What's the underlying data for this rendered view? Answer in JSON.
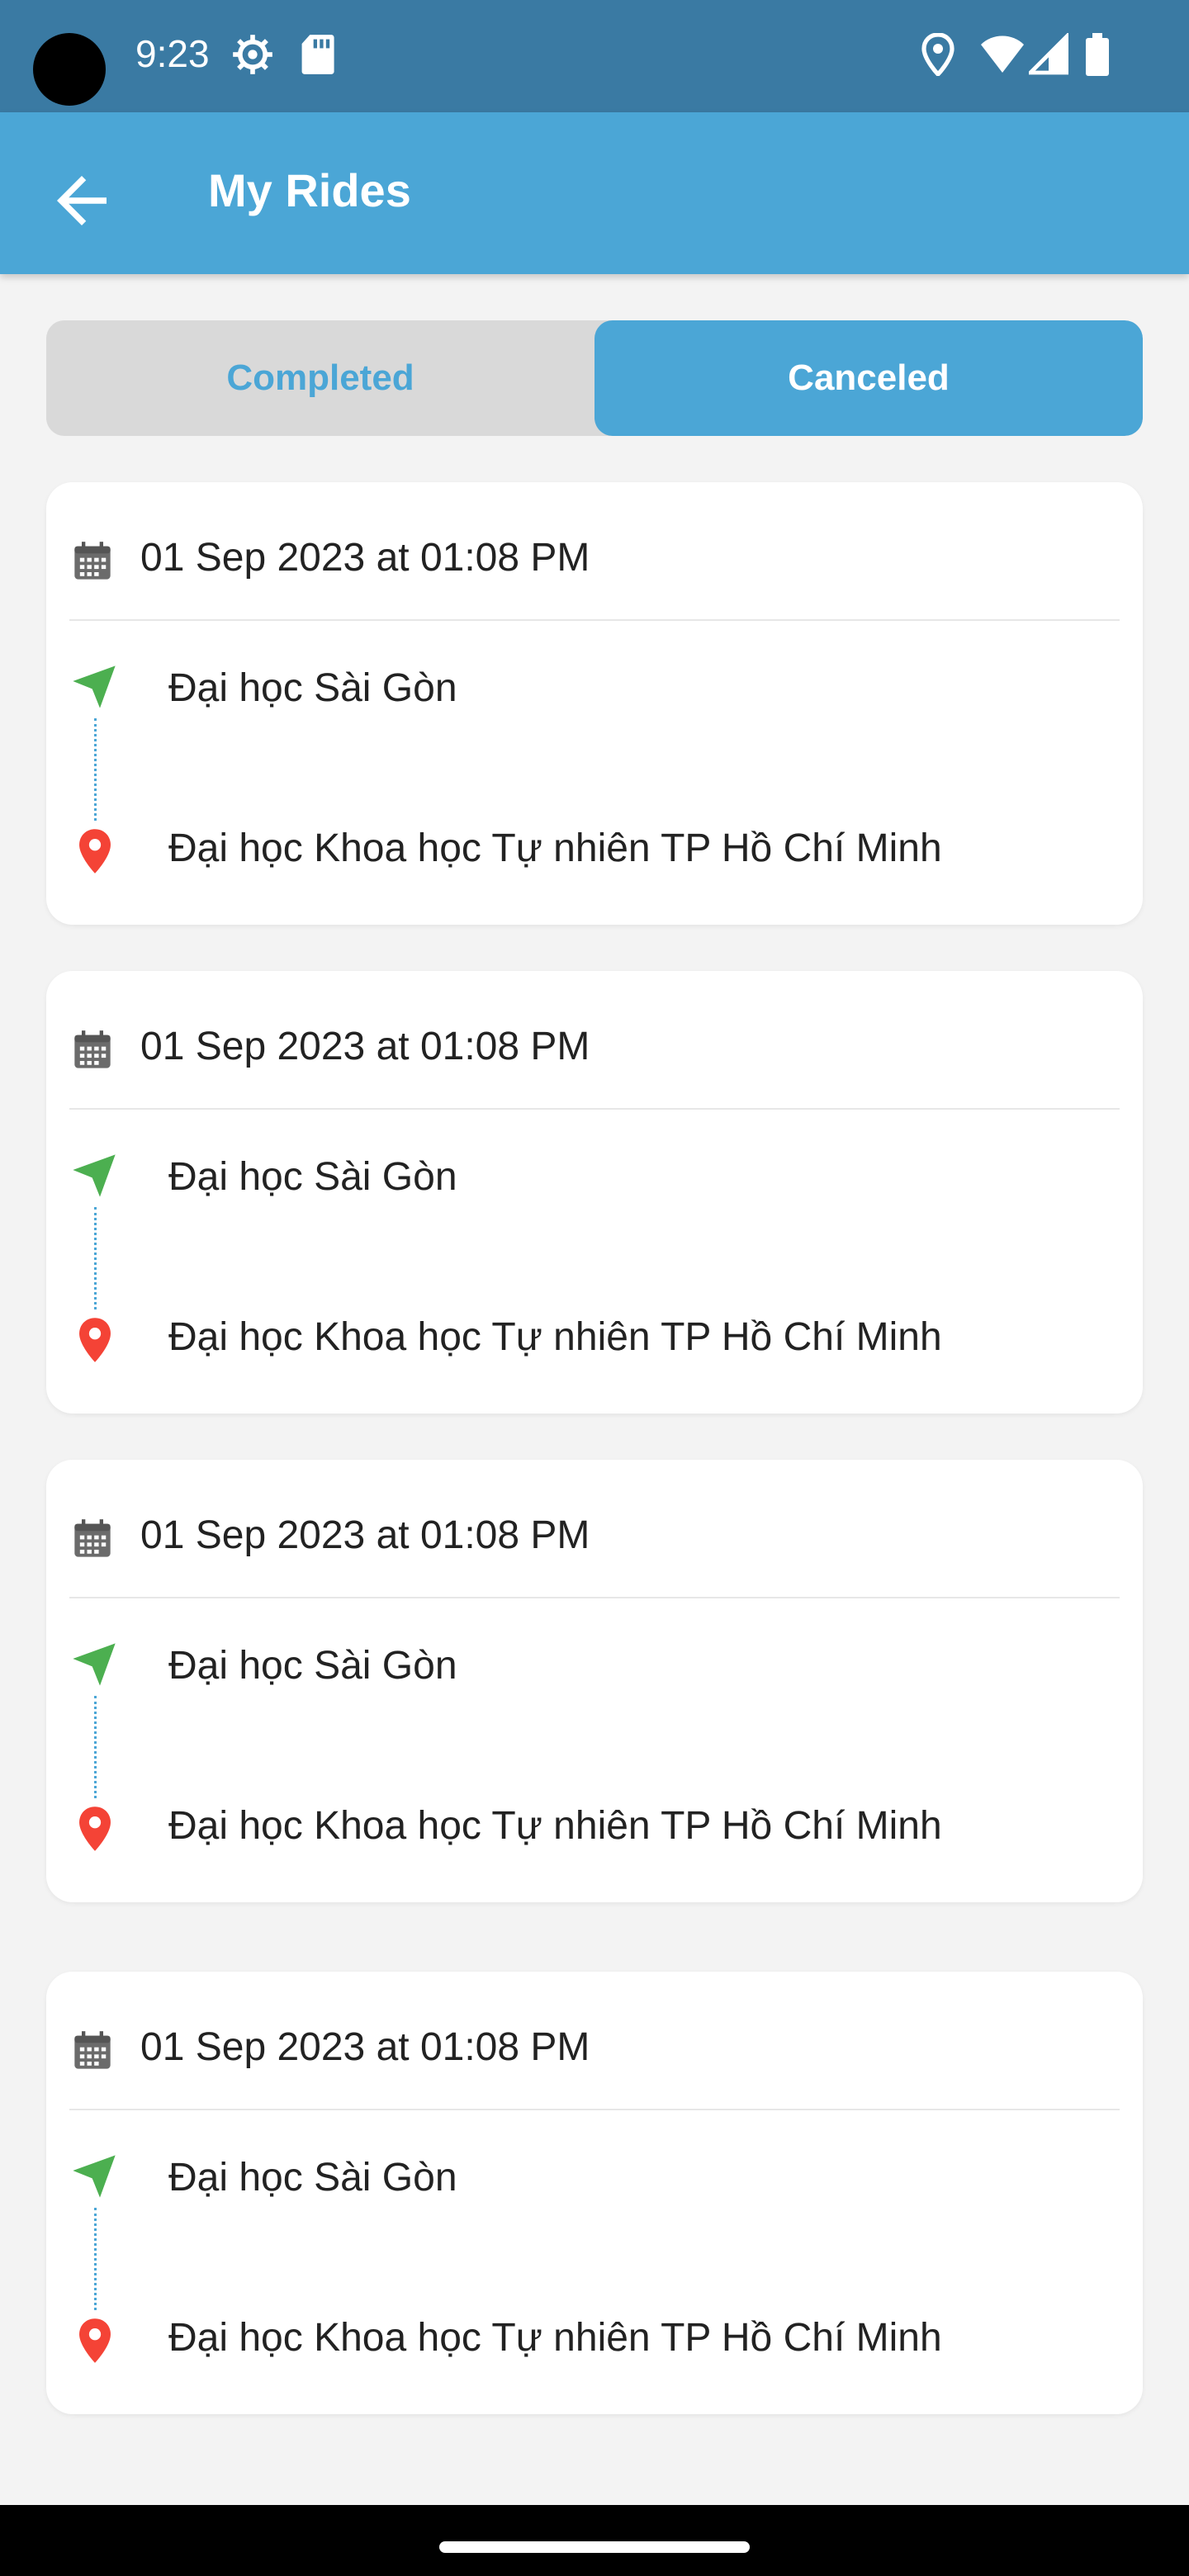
{
  "status_bar": {
    "time": "9:23"
  },
  "app_bar": {
    "title": "My Rides"
  },
  "tabs": [
    {
      "label": "Completed",
      "selected": false
    },
    {
      "label": "Canceled",
      "selected": true
    }
  ],
  "rides": [
    {
      "date": "01 Sep 2023 at 01:08 PM",
      "pickup": "Đại học Sài Gòn",
      "dropoff": "Đại học Khoa học Tự nhiên TP Hồ Chí Minh"
    },
    {
      "date": "01 Sep 2023 at 01:08 PM",
      "pickup": "Đại học Sài Gòn",
      "dropoff": "Đại học Khoa học Tự nhiên TP Hồ Chí Minh"
    },
    {
      "date": "01 Sep 2023 at 01:08 PM",
      "pickup": "Đại học Sài Gòn",
      "dropoff": "Đại học Khoa học Tự nhiên TP Hồ Chí Minh"
    },
    {
      "date": "01 Sep 2023 at 01:08 PM",
      "pickup": "Đại học Sài Gòn",
      "dropoff": "Đại học Khoa học Tự nhiên TP Hồ Chí Minh"
    }
  ],
  "icons": {
    "back": "arrow-left-icon",
    "calendar": "calendar-icon",
    "pickup": "navigation-arrow-icon",
    "dropoff": "map-pin-icon"
  },
  "colors": {
    "status_bar": "#3a7aa3",
    "app_bar": "#4ba6d6",
    "accent": "#4ba6d6",
    "pickup_green": "#4caf50",
    "dropoff_red": "#f44336"
  }
}
